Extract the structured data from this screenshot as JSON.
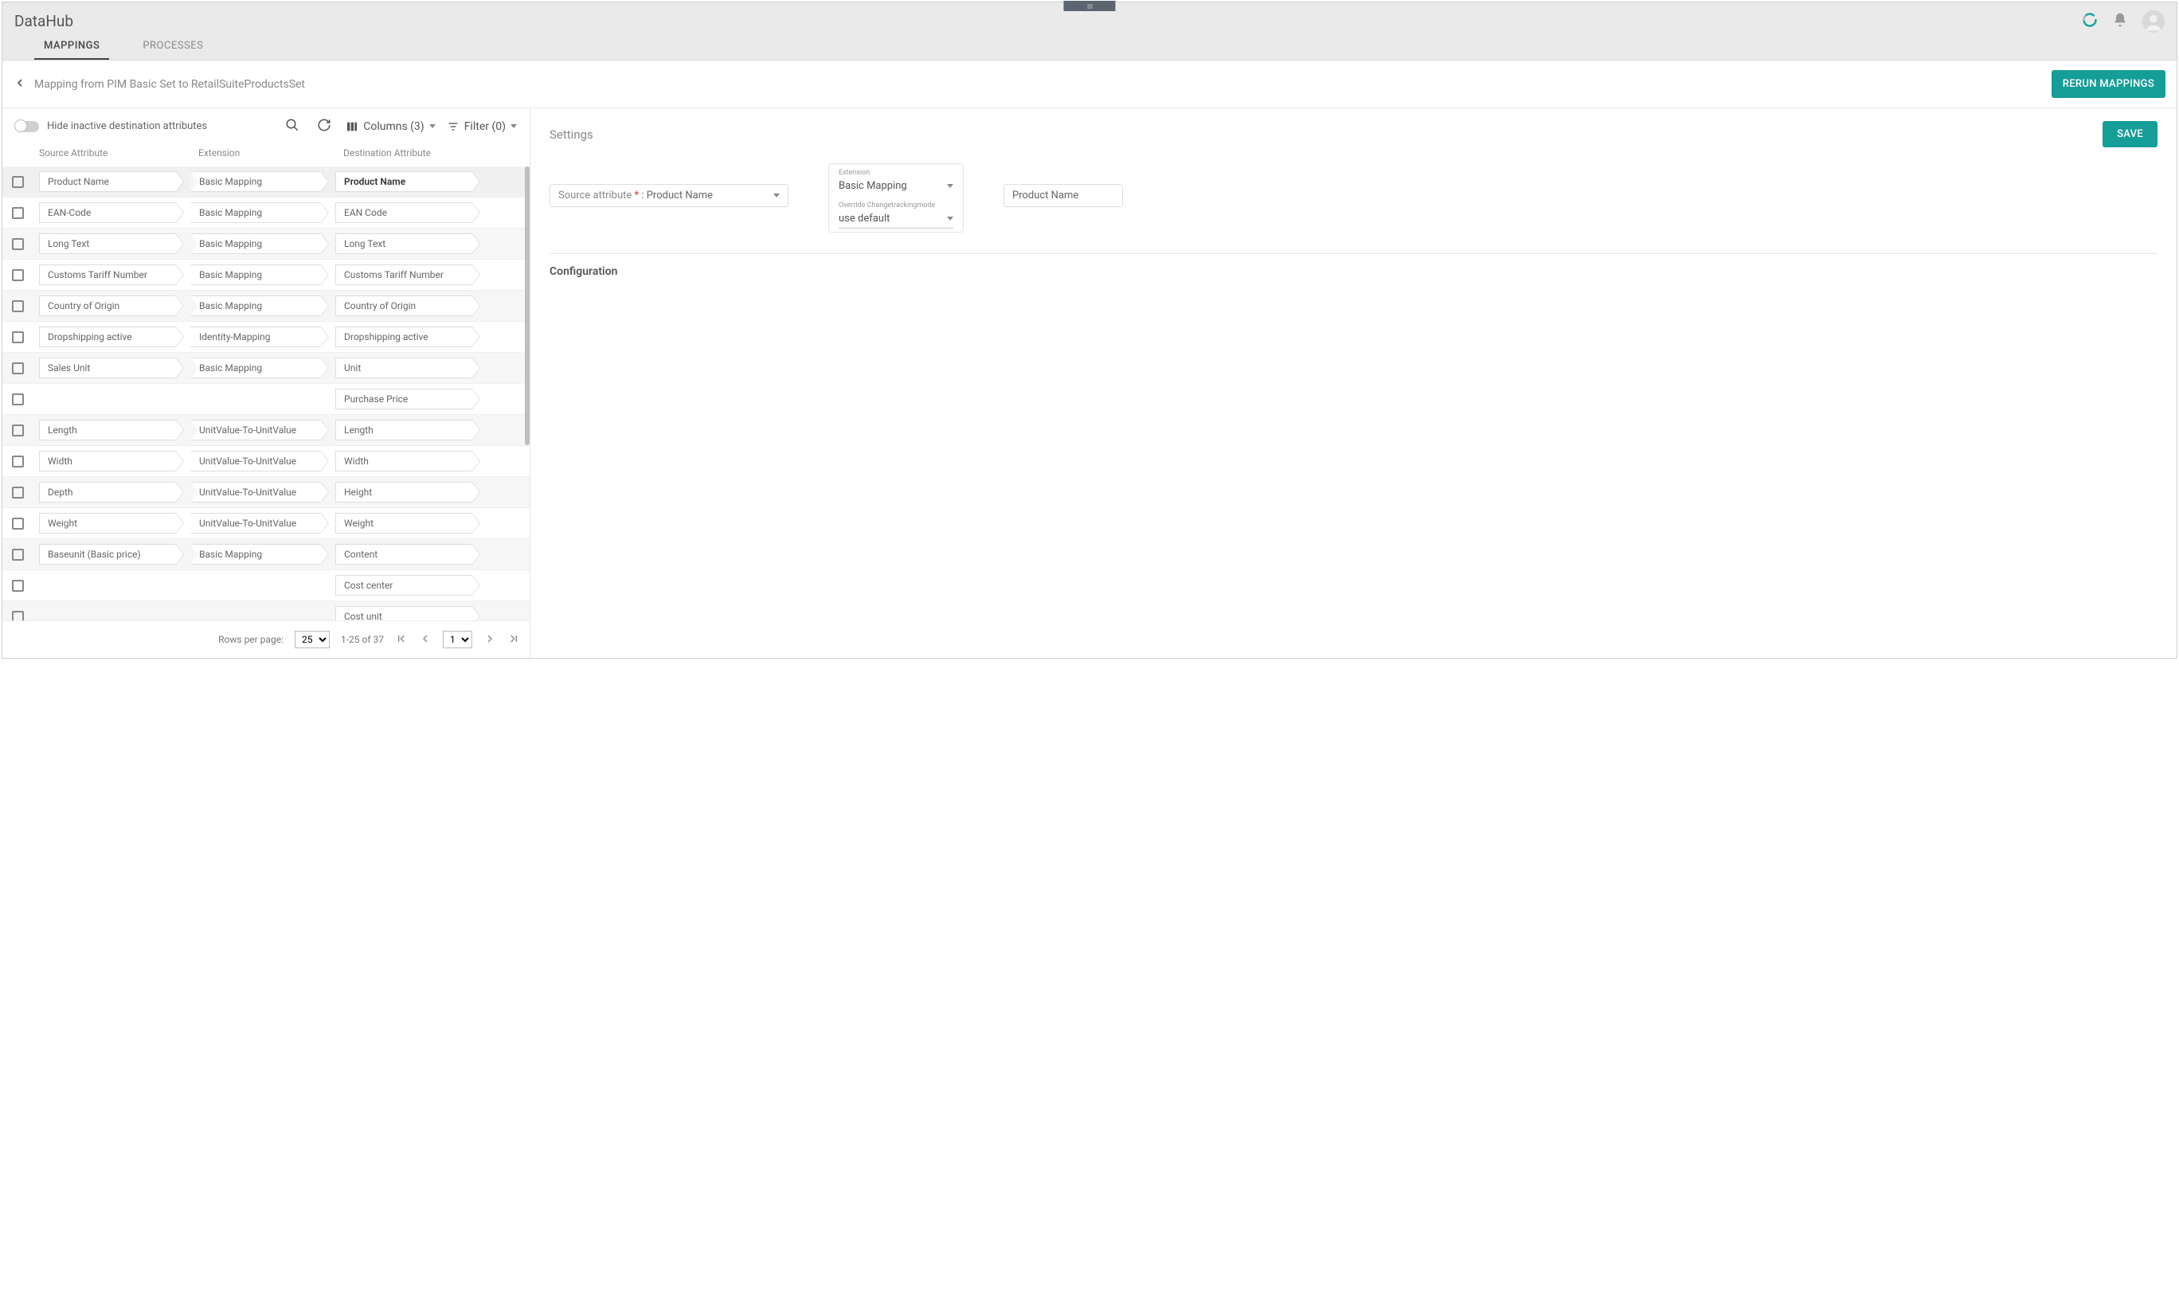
{
  "app": {
    "title": "DataHub"
  },
  "tabs": {
    "mappings": "MAPPINGS",
    "processes": "PROCESSES"
  },
  "subheader": {
    "breadcrumb": "Mapping from PIM Basic Set to RetailSuiteProductsSet",
    "rerun_btn": "RERUN MAPPINGS"
  },
  "toolbar": {
    "toggle_label": "Hide inactive destination attributes",
    "columns_label": "Columns (3)",
    "filter_label": "Filter (0)"
  },
  "table": {
    "headers": {
      "source": "Source Attribute",
      "extension": "Extension",
      "destination": "Destination Attribute"
    },
    "rows": [
      {
        "source": "Product Name",
        "ext": "Basic Mapping",
        "dest": "Product Name",
        "selected": true
      },
      {
        "source": "EAN-Code",
        "ext": "Basic Mapping",
        "dest": "EAN Code"
      },
      {
        "source": "Long Text",
        "ext": "Basic Mapping",
        "dest": "Long Text"
      },
      {
        "source": "Customs Tariff Number",
        "ext": "Basic Mapping",
        "dest": "Customs Tariff Number"
      },
      {
        "source": "Country of Origin",
        "ext": "Basic Mapping",
        "dest": "Country of Origin"
      },
      {
        "source": "Dropshipping active",
        "ext": "Identity-Mapping",
        "dest": "Dropshipping active"
      },
      {
        "source": "Sales Unit",
        "ext": "Basic Mapping",
        "dest": "Unit"
      },
      {
        "source": "",
        "ext": "",
        "dest": "Purchase Price"
      },
      {
        "source": "Length",
        "ext": "UnitValue-To-UnitValue",
        "dest": "Length"
      },
      {
        "source": "Width",
        "ext": "UnitValue-To-UnitValue",
        "dest": "Width"
      },
      {
        "source": "Depth",
        "ext": "UnitValue-To-UnitValue",
        "dest": "Height"
      },
      {
        "source": "Weight",
        "ext": "UnitValue-To-UnitValue",
        "dest": "Weight"
      },
      {
        "source": "Baseunit (Basic price)",
        "ext": "Basic Mapping",
        "dest": "Content"
      },
      {
        "source": "",
        "ext": "",
        "dest": "Cost center"
      },
      {
        "source": "",
        "ext": "",
        "dest": "Cost unit"
      }
    ]
  },
  "pagination": {
    "rows_label": "Rows per page:",
    "page_size": "25",
    "range": "1-25 of 37",
    "page": "1"
  },
  "settings": {
    "title": "Settings",
    "save_btn": "SAVE",
    "source_label": "Source attribute",
    "source_value": "Product Name",
    "extension_label": "Extension",
    "extension_value": "Basic Mapping",
    "changetracking_label": "Override Changetrackingmode",
    "changetracking_value": "use default",
    "dest_value": "Product Name",
    "config_title": "Configuration"
  }
}
